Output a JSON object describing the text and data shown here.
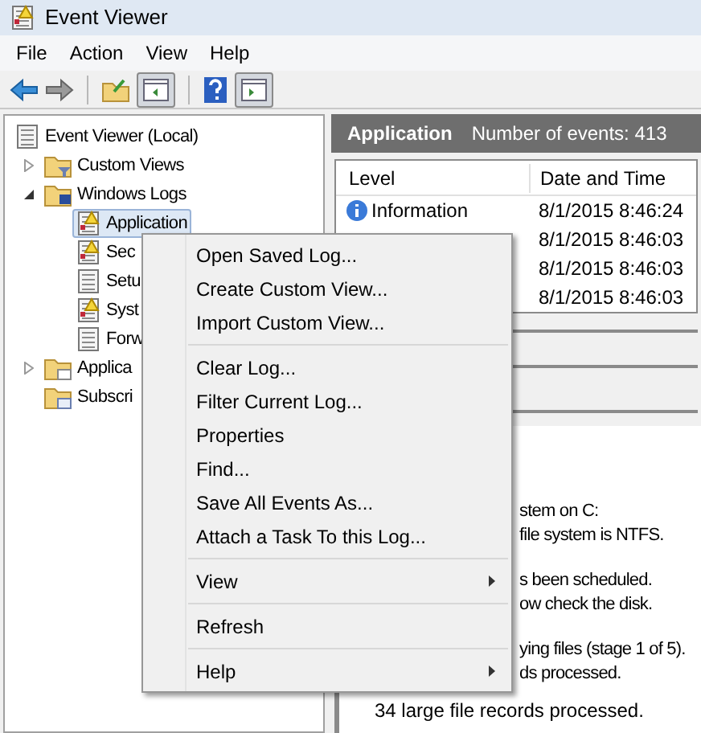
{
  "window": {
    "title": "Event Viewer"
  },
  "menu_bar": [
    "File",
    "Action",
    "View",
    "Help"
  ],
  "toolbar": [
    {
      "kind": "back"
    },
    {
      "kind": "forward"
    },
    {
      "kind": "sep"
    },
    {
      "kind": "folder"
    },
    {
      "kind": "pane",
      "selected": true
    },
    {
      "kind": "sep"
    },
    {
      "kind": "help"
    },
    {
      "kind": "pane2",
      "selected": true
    }
  ],
  "tree": [
    {
      "label": "Event Viewer (Local)",
      "selected": false,
      "children": [
        {
          "label": "Custom Views",
          "expanded": false,
          "selected": false
        },
        {
          "label": "Windows Logs",
          "expanded": true,
          "selected": false,
          "children": [
            {
              "label": "Application",
              "selected": true
            },
            {
              "label": "Sec",
              "selected": false
            },
            {
              "label": "Setu",
              "selected": false
            },
            {
              "label": "Syst",
              "selected": false
            },
            {
              "label": "Forw",
              "selected": false
            }
          ]
        },
        {
          "label": "Applica",
          "expanded": false,
          "selected": false
        },
        {
          "label": "Subscri",
          "selected": false
        }
      ]
    }
  ],
  "pane": {
    "title": "Application",
    "subtitle": "Number of events: 413"
  },
  "table": {
    "columns": [
      "Level",
      "Date and Time"
    ],
    "rows": [
      {
        "level": "Information",
        "time": "8/1/2015 8:46:24"
      },
      {
        "time": "8/1/2015 8:46:03"
      },
      {
        "time": "8/1/2015 8:46:03"
      },
      {
        "time": "8/1/2015 8:46:03"
      }
    ]
  },
  "details": [
    {
      "kind": "clipped",
      "lines": [
        "stem on C:",
        "file system is NTFS."
      ]
    },
    {
      "kind": "clipped",
      "lines": [
        "s been scheduled.",
        "ow check the disk."
      ]
    },
    {
      "kind": "clipped",
      "lines": [
        "ying files (stage 1 of 5).",
        "ds processed."
      ]
    },
    {
      "kind": "full",
      "lines": [
        "34 large file records processed."
      ]
    }
  ],
  "context_menu": [
    {
      "label": "Open Saved Log...",
      "submenu": false
    },
    {
      "label": "Create Custom View...",
      "submenu": false
    },
    {
      "label": "Import Custom View...",
      "submenu": false
    },
    {
      "kind": "separator"
    },
    {
      "label": "Clear Log...",
      "submenu": false
    },
    {
      "label": "Filter Current Log...",
      "submenu": false
    },
    {
      "label": "Properties",
      "submenu": false
    },
    {
      "label": "Find...",
      "submenu": false
    },
    {
      "label": "Save All Events As...",
      "submenu": false
    },
    {
      "label": "Attach a Task To this Log...",
      "submenu": false
    },
    {
      "kind": "separator"
    },
    {
      "label": "View",
      "submenu": true
    },
    {
      "kind": "separator"
    },
    {
      "label": "Refresh",
      "submenu": false
    },
    {
      "kind": "separator"
    },
    {
      "label": "Help",
      "submenu": true
    }
  ]
}
